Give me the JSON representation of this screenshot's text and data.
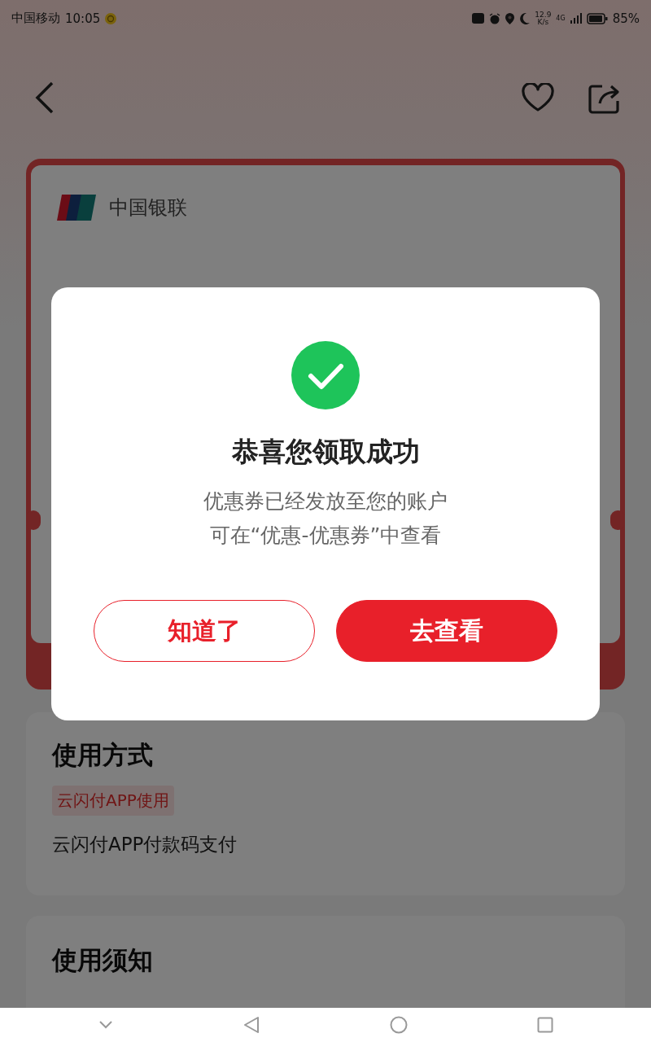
{
  "status_bar": {
    "carrier": "中国移动",
    "time": "10:05",
    "network_speed": "12.9",
    "speed_unit": "K/s",
    "network_type": "4G",
    "battery": "85%"
  },
  "coupon": {
    "issuer": "中国银联"
  },
  "usage": {
    "title": "使用方式",
    "tag": "云闪付APP使用",
    "description": "云闪付APP付款码支付"
  },
  "notice": {
    "title": "使用须知"
  },
  "dialog": {
    "title": "恭喜您领取成功",
    "message_lines": [
      "优惠券已经发放至您的账户",
      "可在“优惠-优惠券”中查看"
    ],
    "buttons": [
      {
        "label": "知道了",
        "kind": "secondary"
      },
      {
        "label": "去查看",
        "kind": "primary"
      }
    ]
  }
}
